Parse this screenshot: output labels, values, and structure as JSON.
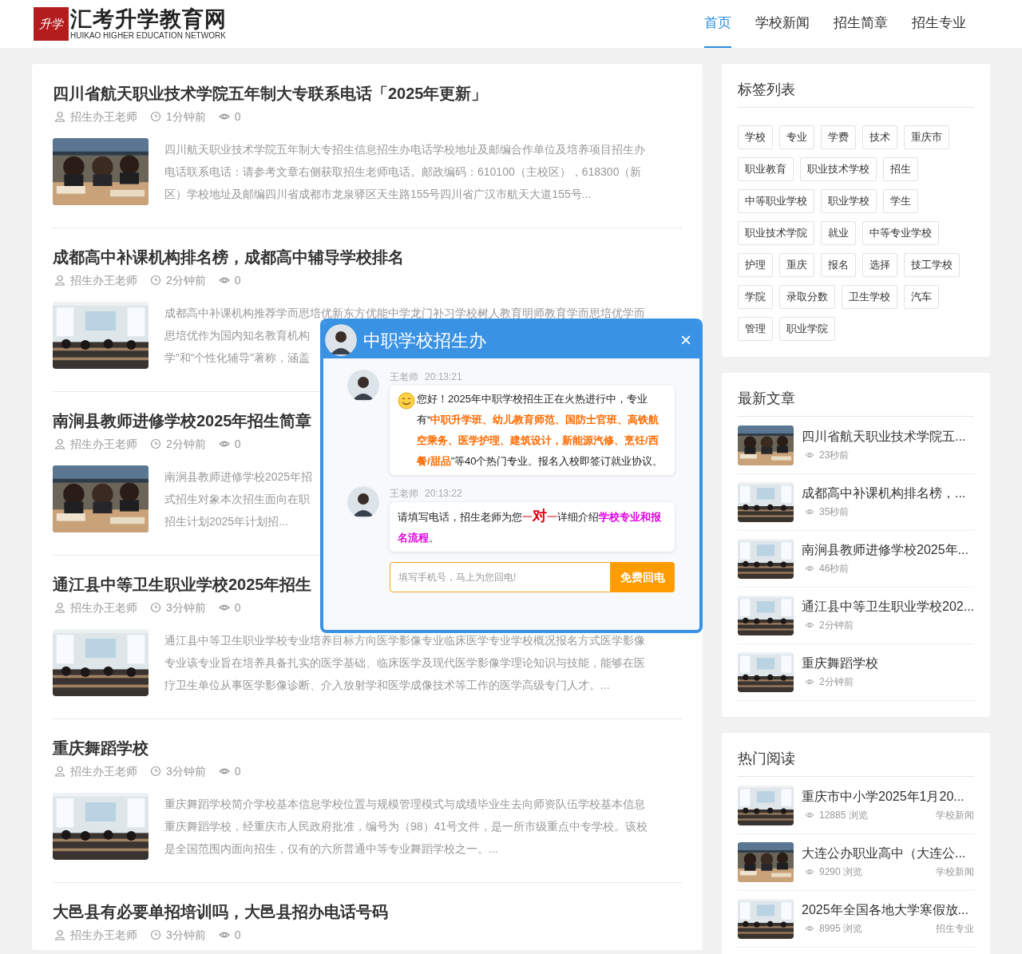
{
  "header": {
    "logo_mark": "升学",
    "logo_title": "汇考升学教育网",
    "logo_subtitle": "HUIKAO HIGHER EDUCATION NETWORK",
    "nav": [
      {
        "label": "首页",
        "selected": true
      },
      {
        "label": "学校新闻",
        "selected": false
      },
      {
        "label": "招生简章",
        "selected": false
      },
      {
        "label": "招生专业",
        "selected": false
      }
    ]
  },
  "articles": [
    {
      "title": "四川省航天职业技术学院五年制大专联系电话「2025年更新」",
      "author": "招生办王老师",
      "time": "1分钟前",
      "views": "0",
      "excerpt_lines": [
        "四川航天职业技术学院五年制大专招生信息招生办电话学校地址及邮编合作单位及培养项目招生办",
        "电话联系电话：请参考文章右侧获取招生老师电话。邮政编码：610100（主校区），618300（新",
        "区）学校地址及邮编四川省成都市龙泉驿区天生路155号四川省广汉市航天大道155号..."
      ]
    },
    {
      "title": "成都高中补课机构排名榜，成都高中辅导学校排名",
      "author": "招生办王老师",
      "time": "2分钟前",
      "views": "0",
      "excerpt_lines": [
        "成都高中补课机构推荐学而思培优新东方优能中学龙门补习学校树人教育明师教育学而思培优学而",
        "思培优作为国内知名教育机构",
        "学”和“个性化辅导”著称，涵盖"
      ]
    },
    {
      "title": "南涧县教师进修学校2025年招生简章",
      "author": "招生办王老师",
      "time": "2分钟前",
      "views": "0",
      "excerpt_lines": [
        "南涧县教师进修学校2025年招",
        "式招生对象本次招生面向在职",
        "招生计划2025年计划招..."
      ]
    },
    {
      "title": "通江县中等卫生职业学校2025年招生",
      "author": "招生办王老师",
      "time": "3分钟前",
      "views": "0",
      "excerpt_lines": [
        "通江县中等卫生职业学校专业培养目标方向医学影像专业临床医学专业学校概况报名方式医学影像",
        "专业该专业旨在培养具备扎实的医学基础、临床医学及现代医学影像学理论知识与技能，能够在医",
        "疗卫生单位从事医学影像诊断、介入放射学和医学成像技术等工作的医学高级专门人才。..."
      ]
    },
    {
      "title": "重庆舞蹈学校",
      "author": "招生办王老师",
      "time": "3分钟前",
      "views": "0",
      "excerpt_lines": [
        "重庆舞蹈学校简介学校基本信息学校位置与规模管理模式与成绩毕业生去向师资队伍学校基本信息",
        "重庆舞蹈学校，经重庆市人民政府批准，编号为（98）41号文件，是一所市级重点中专学校。该校",
        "是全国范围内面向招生，仅有的六所普通中等专业舞蹈学校之一。..."
      ]
    },
    {
      "title": "大邑县有必要单招培训吗，大邑县招办电话号码",
      "author": "招生办王老师",
      "time": "3分钟前",
      "views": "0"
    }
  ],
  "sidebar": {
    "tags": {
      "title": "标签列表",
      "items": [
        "学校",
        "专业",
        "学费",
        "技术",
        "重庆市",
        "职业教育",
        "职业技术学校",
        "招生",
        "中等职业学校",
        "职业学校",
        "学生",
        "职业技术学院",
        "就业",
        "中等专业学校",
        "护理",
        "重庆",
        "报名",
        "选择",
        "技工学校",
        "学院",
        "录取分数",
        "卫生学校",
        "汽车",
        "管理",
        "职业学院"
      ]
    },
    "latest": {
      "title": "最新文章",
      "items": [
        {
          "title": "四川省航天职业技术学院五...",
          "meta": "23秒前"
        },
        {
          "title": "成都高中补课机构排名榜，...",
          "meta": "35秒前"
        },
        {
          "title": "南涧县教师进修学校2025年...",
          "meta": "46秒前"
        },
        {
          "title": "通江县中等卫生职业学校202...",
          "meta": "2分钟前"
        },
        {
          "title": "重庆舞蹈学校",
          "meta": "2分钟前"
        }
      ]
    },
    "hot": {
      "title": "热门阅读",
      "items": [
        {
          "title": "重庆市中小学2025年1月20...",
          "views": "12885 浏览",
          "category": "学校新闻"
        },
        {
          "title": "大连公办职业高中（大连公...",
          "views": "9290 浏览",
          "category": "学校新闻"
        },
        {
          "title": "2025年全国各地大学寒假放...",
          "views": "8995 浏览",
          "category": "招生专业"
        }
      ]
    }
  },
  "chat": {
    "title": "中职学校招生办",
    "close": "×",
    "messages": [
      {
        "sender": "王老师",
        "time": "20:13:21",
        "segments": [
          {
            "kind": "smiley"
          },
          {
            "kind": "plain",
            "text": "您好！2025年中职学校招生正在火热进行中，专业有“"
          },
          {
            "kind": "orange",
            "text": "中职升学班、幼儿教育师范、国防士官班、高铁航空乘务、医学护理、建筑设计，新能源汽修、烹饪/西餐/甜品"
          },
          {
            "kind": "plain",
            "text": "”等40个热门专业。报名入校即签订就业协议。"
          }
        ]
      },
      {
        "sender": "王老师",
        "time": "20:13:22",
        "segments": [
          {
            "kind": "plain",
            "text": "请填写电话，招生老师为您"
          },
          {
            "kind": "red",
            "text": "一"
          },
          {
            "kind": "red_big",
            "text": "对"
          },
          {
            "kind": "red",
            "text": "一"
          },
          {
            "kind": "plain",
            "text": "详细介绍"
          },
          {
            "kind": "magenta",
            "text": "学校专业和报名流程"
          },
          {
            "kind": "plain",
            "text": "。"
          }
        ]
      }
    ],
    "phone_placeholder": "填写手机号，马上为您回电!",
    "callback_button": "免费回电"
  }
}
